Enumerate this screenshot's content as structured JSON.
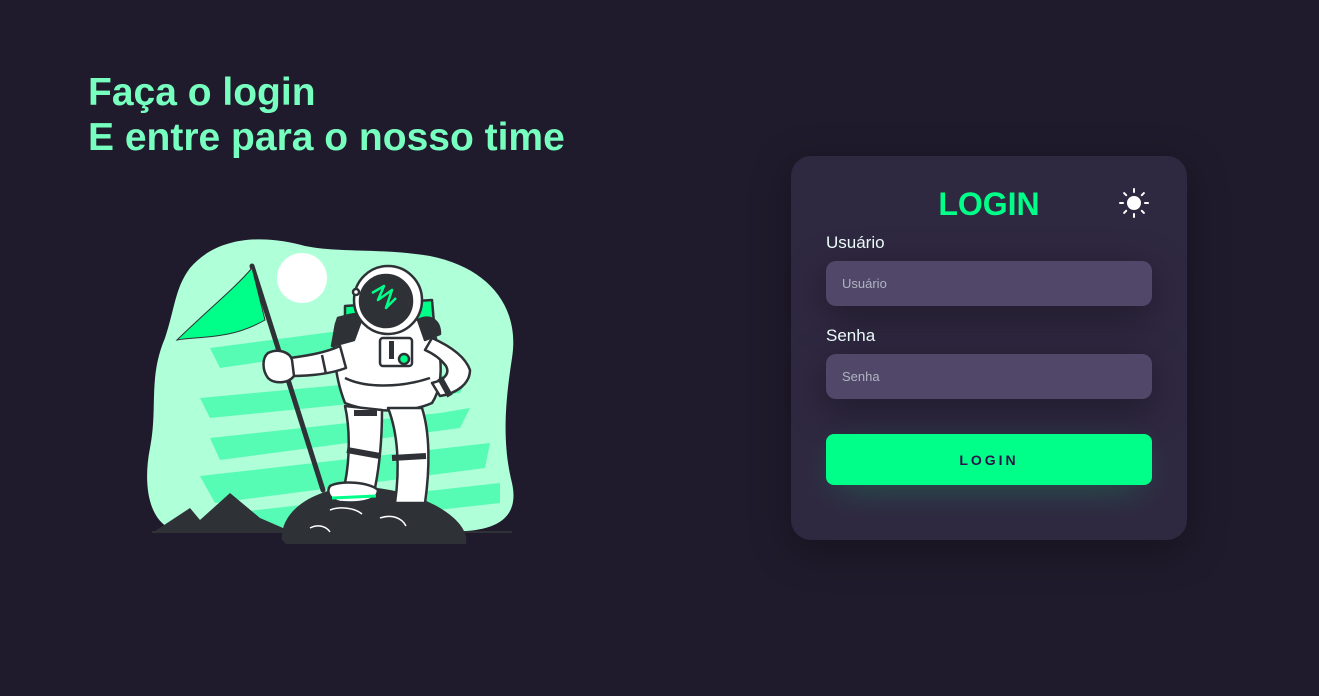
{
  "hero": {
    "line1": "Faça o login",
    "line2": "E entre para o nosso time"
  },
  "login_card": {
    "title": "LOGIN",
    "theme_icon": "sun-icon",
    "username": {
      "label": "Usuário",
      "placeholder": "Usuário",
      "value": ""
    },
    "password": {
      "label": "Senha",
      "placeholder": "Senha",
      "value": ""
    },
    "submit_label": "LOGIN"
  },
  "colors": {
    "background": "#201b2c",
    "card": "#2f2841",
    "input": "#514869",
    "accent": "#00ff88",
    "hero_text": "#77ffc0",
    "label_text": "#f0ffff"
  },
  "illustration": {
    "icon": "astronaut-with-flag-illustration"
  }
}
